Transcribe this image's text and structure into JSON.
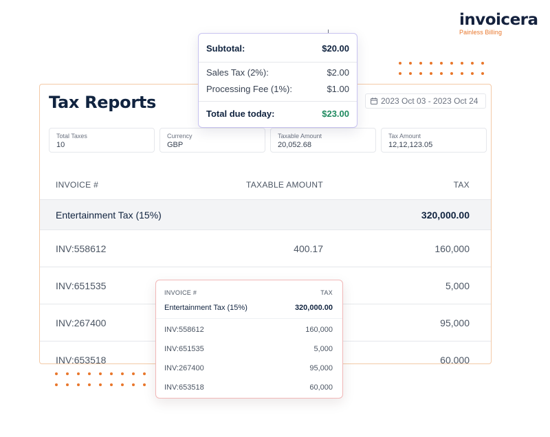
{
  "brand": {
    "name": "invoicera",
    "tagline": "Painless Billing",
    "accent_color": "#e8762b",
    "navy_color": "#10233f"
  },
  "report": {
    "title": "Tax Reports",
    "date_range": "2023 Oct 03 - 2023 Oct 24",
    "calendar_icon": "calendar-icon",
    "stats": [
      {
        "label": "Total Taxes",
        "value": "10"
      },
      {
        "label": "Currency",
        "value": "GBP"
      },
      {
        "label": "Taxable Amount",
        "value": "20,052.68"
      },
      {
        "label": "Tax Amount",
        "value": "12,12,123.05"
      }
    ],
    "columns": {
      "invoice": "INVOICE #",
      "taxable": "TAXABLE AMOUNT",
      "tax": "TAX"
    },
    "group": {
      "name": "Entertainment Tax (15%)",
      "total": "320,000.00"
    },
    "rows": [
      {
        "invoice": "INV:558612",
        "taxable": "400.17",
        "tax": "160,000"
      },
      {
        "invoice": "INV:651535",
        "taxable": "",
        "tax": "5,000"
      },
      {
        "invoice": "INV:267400",
        "taxable": "",
        "tax": "95,000"
      },
      {
        "invoice": "INV:653518",
        "taxable": "",
        "tax": "60,000"
      }
    ]
  },
  "summary": {
    "subtotal_label": "Subtotal:",
    "subtotal_value": "$20.00",
    "sales_tax_label": "Sales Tax (2%):",
    "sales_tax_value": "$2.00",
    "processing_label": "Processing Fee (1%):",
    "processing_value": "$1.00",
    "total_label": "Total due today:",
    "total_value": "$23.00",
    "total_color": "#1f8a5f"
  },
  "mini_table": {
    "col_invoice": "INVOICE #",
    "col_tax": "TAX",
    "group_name": "Entertainment Tax (15%)",
    "group_total": "320,000.00",
    "rows": [
      {
        "invoice": "INV:558612",
        "tax": "160,000"
      },
      {
        "invoice": "INV:651535",
        "tax": "5,000"
      },
      {
        "invoice": "INV:267400",
        "tax": "95,000"
      },
      {
        "invoice": "INV:653518",
        "tax": "60,000"
      }
    ]
  }
}
